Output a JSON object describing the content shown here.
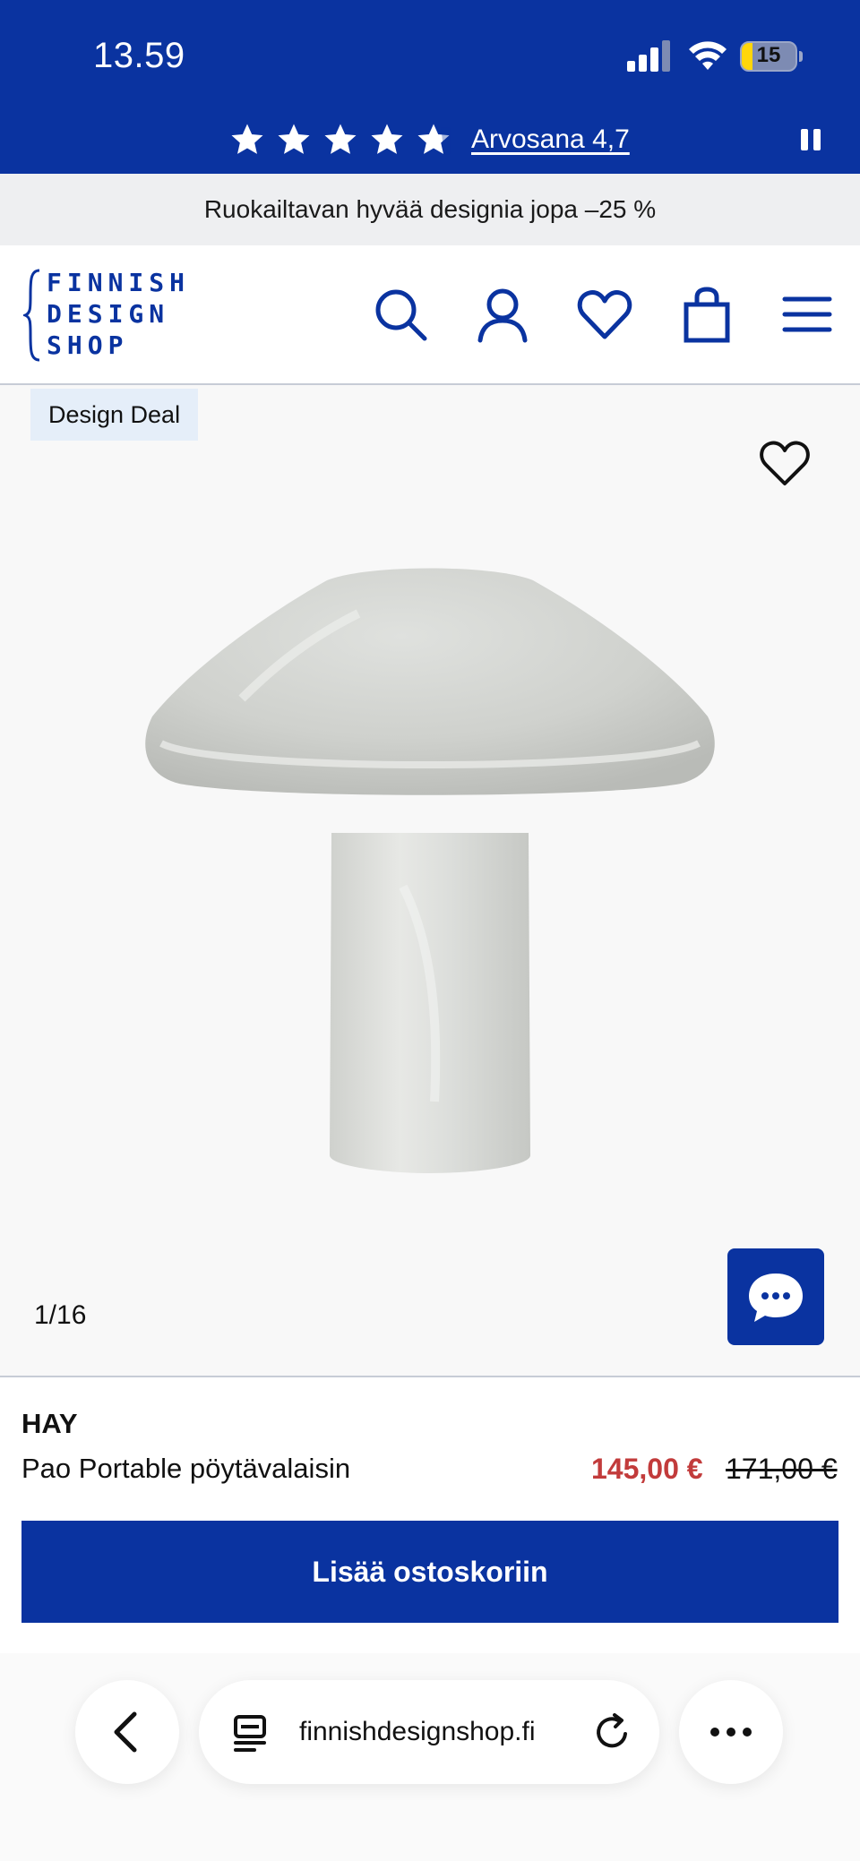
{
  "status_bar": {
    "time": "13.59",
    "battery_level": "15",
    "icons": [
      "signal-icon",
      "wifi-icon",
      "battery-icon"
    ]
  },
  "rating_banner": {
    "stars": 5,
    "rating_link": "Arvosana 4,7",
    "pause_icon": "pause-icon"
  },
  "promo": {
    "text": "Ruokailtavan hyvää designia jopa –25 %"
  },
  "header": {
    "logo_lines": [
      "FINNISH",
      "DESIGN",
      "SHOP"
    ],
    "icons": [
      "search-icon",
      "account-icon",
      "wishlist-icon",
      "cart-icon",
      "menu-icon"
    ],
    "brand_color": "#0a33a0"
  },
  "gallery": {
    "badge": "Design Deal",
    "counter": "1/16",
    "chat_icon": "chat-icon"
  },
  "product": {
    "brand": "HAY",
    "name": "Pao Portable pöytävalaisin",
    "sale_price": "145,00 €",
    "original_price": "171,00 €",
    "sale_color": "#c23b3b"
  },
  "cta": {
    "add_to_cart": "Lisää ostoskoriin"
  },
  "browser": {
    "url": "finnishdesignshop.fi",
    "icons": [
      "back-icon",
      "reader-icon",
      "reload-icon",
      "more-icon"
    ]
  }
}
